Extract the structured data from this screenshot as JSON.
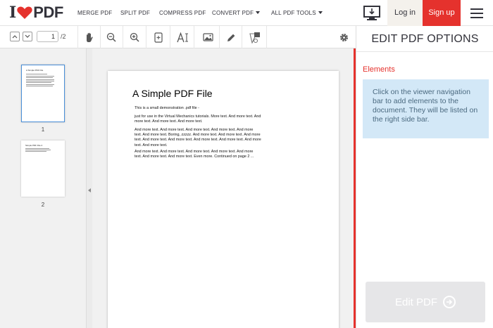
{
  "brand": {
    "logo_letter": "I",
    "logo_word": "PDF",
    "heart_color": "#e5322d"
  },
  "nav": {
    "merge": "MERGE PDF",
    "split": "SPLIT PDF",
    "compress": "COMPRESS PDF",
    "convert": "CONVERT PDF",
    "all_tools": "ALL PDF TOOLS",
    "desktop_icon": "desktop-download-icon",
    "login": "Log in",
    "signup": "Sign up",
    "menu_icon": "hamburger-icon"
  },
  "toolbar": {
    "prev_icon": "chevron-up-icon",
    "next_icon": "chevron-down-icon",
    "current_page": "1",
    "total_pages": "/2",
    "tools": [
      "hand-icon",
      "zoom-out-icon",
      "zoom-in-icon",
      "fit-page-icon",
      "text-tool-icon",
      "image-tool-icon",
      "pencil-icon",
      "shape-tool-icon",
      "gear-icon"
    ]
  },
  "thumbnails": [
    {
      "label": "1",
      "title": "A Simple PDF File",
      "selected": true
    },
    {
      "label": "2",
      "title": "Simple PDF File 2",
      "selected": false
    }
  ],
  "document": {
    "title": "A Simple PDF File",
    "paragraphs": [
      "This is a small demonstration .pdf file -",
      "just for use in the Virtual Mechanics tutorials. More text. And more text. And more text. And more text. And more text.",
      "And more text. And more text. And more text. And more text. And more text. And more text. Boring, zzzzz. And more text. And more text. And more text. And more text. And more text. And more text. And more text. And more text. And more text.",
      "And more text. And more text. And more text. And more text. And more text. And more text. And more text. Even more. Continued on page 2 ..."
    ]
  },
  "options_panel": {
    "title": "EDIT PDF OPTIONS",
    "section_label": "Elements",
    "info_text": "Click on the viewer navigation bar to add elements to the document. They will be listed on the right side bar.",
    "action_label": "Edit PDF",
    "action_icon": "arrow-right-circle-icon"
  },
  "colors": {
    "accent": "#e5322d",
    "info_bg": "#d3e8f7",
    "text_dark": "#33333b"
  }
}
